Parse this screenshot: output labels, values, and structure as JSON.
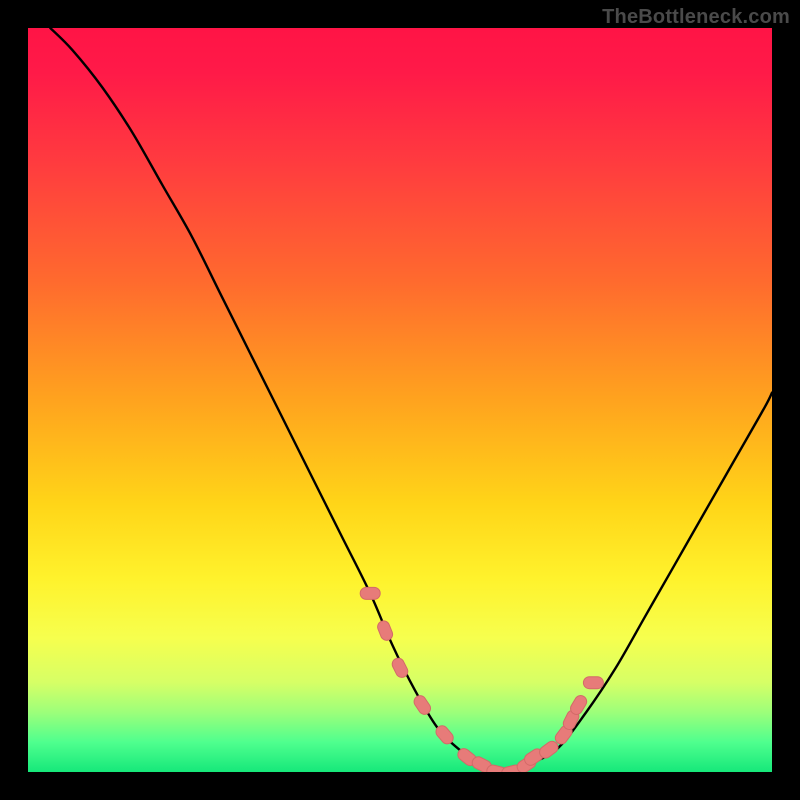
{
  "watermark": "TheBottleneck.com",
  "colors": {
    "frame": "#000000",
    "curve": "#000000",
    "marker_fill": "#e77b79",
    "marker_stroke": "#d36a68"
  },
  "chart_data": {
    "type": "line",
    "title": "",
    "xlabel": "",
    "ylabel": "",
    "xlim": [
      0,
      100
    ],
    "ylim": [
      0,
      100
    ],
    "grid": false,
    "legend": false,
    "series": [
      {
        "name": "bottleneck-curve",
        "x": [
          3,
          6,
          10,
          14,
          18,
          22,
          26,
          30,
          34,
          38,
          42,
          46,
          49,
          52,
          55,
          58,
          61,
          64,
          67,
          71,
          75,
          79,
          83,
          87,
          91,
          95,
          99,
          100
        ],
        "y": [
          100,
          97,
          92,
          86,
          79,
          72,
          64,
          56,
          48,
          40,
          32,
          24,
          17,
          11,
          6,
          3,
          1,
          0,
          1,
          3,
          8,
          14,
          21,
          28,
          35,
          42,
          49,
          51
        ]
      }
    ],
    "markers": {
      "name": "highlight-dots",
      "x": [
        46,
        48,
        50,
        53,
        56,
        59,
        61,
        63,
        65,
        67,
        68,
        70,
        72,
        73,
        74,
        76
      ],
      "y": [
        24,
        19,
        14,
        9,
        5,
        2,
        1,
        0,
        0,
        1,
        2,
        3,
        5,
        7,
        9,
        12
      ]
    }
  }
}
